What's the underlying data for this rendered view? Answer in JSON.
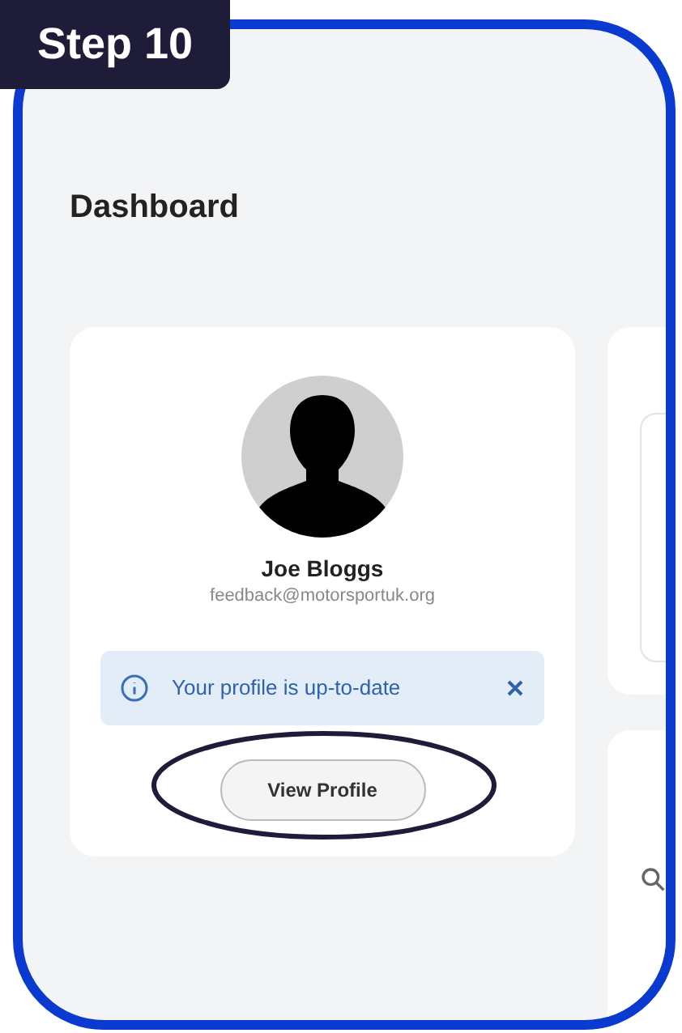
{
  "step_badge": "Step 10",
  "page_title": "Dashboard",
  "profile_card": {
    "name": "Joe Bloggs",
    "email": "feedback@motorsportuk.org",
    "notice": {
      "text": "Your profile is up-to-date"
    },
    "button": "View Profile"
  }
}
